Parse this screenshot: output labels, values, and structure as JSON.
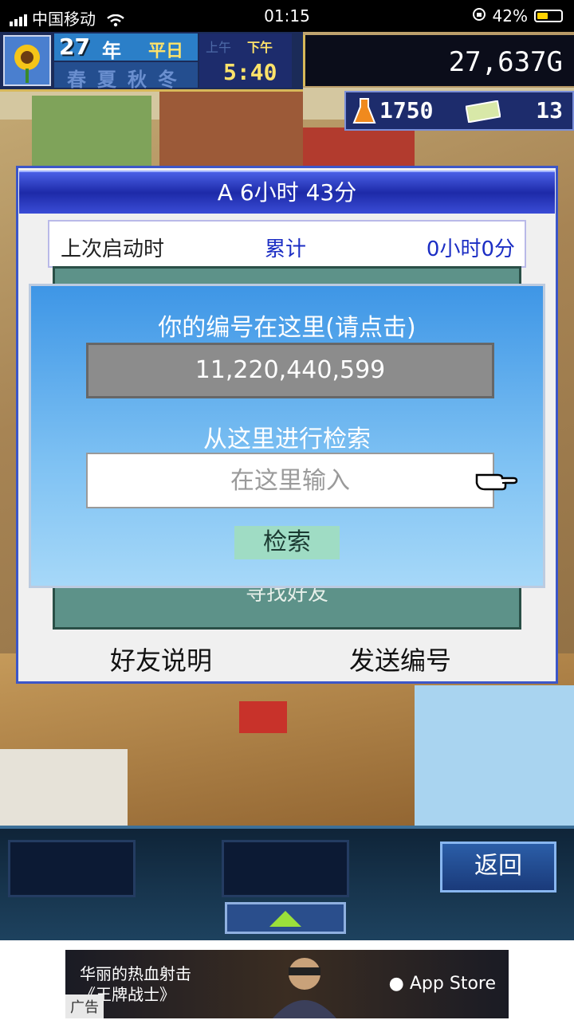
{
  "status_bar": {
    "carrier": "中国移动",
    "time": "01:15",
    "battery": "42%"
  },
  "hud": {
    "year": "27",
    "year_unit": "年",
    "weekday": "平日",
    "am_label": "上午",
    "pm_label": "下午",
    "seasons": "春夏秋冬",
    "clock": "5:40",
    "gold": "27,637G",
    "research_points": "1750",
    "tickets": "13"
  },
  "panel": {
    "title": "A  6小时 43分",
    "last_launch_label": "上次启动时",
    "total_label": "累计",
    "total_value": "0小时0分",
    "find_friend": "寻找好友",
    "friend_explanation": "好友说明",
    "send_id": "发送编号"
  },
  "dialog": {
    "your_id_label": "你的编号在这里(请点击)",
    "your_id": "11,220,440,599",
    "search_label": "从这里进行检索",
    "search_placeholder": "在这里输入",
    "search_button": "检索"
  },
  "bottom": {
    "back_button": "返回"
  },
  "ad": {
    "line1": "华丽的热血射击",
    "line2": "《王牌战士》",
    "store": "App Store",
    "tag": "广告"
  },
  "colors": {
    "panel_title": "#1d2aa8",
    "dialog_bg": "#3e96e6",
    "accent_blue": "#1c2ec4"
  }
}
